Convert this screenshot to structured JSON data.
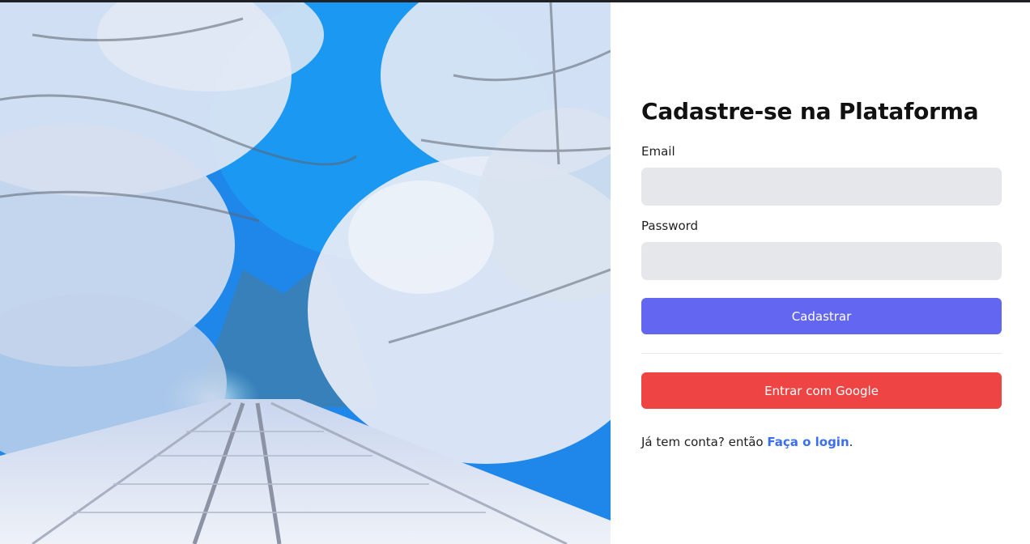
{
  "form": {
    "title": "Cadastre-se na Plataforma",
    "email_label": "Email",
    "email_value": "",
    "password_label": "Password",
    "password_value": "",
    "submit_label": "Cadastrar",
    "google_label": "Entrar com Google",
    "footer_prefix": "Já tem conta? então ",
    "login_link": "Faça o login",
    "footer_suffix": "."
  },
  "colors": {
    "primary": "#6366f1",
    "google": "#ef4444",
    "link": "#3b6ff2",
    "input_bg": "#e5e7eb"
  }
}
